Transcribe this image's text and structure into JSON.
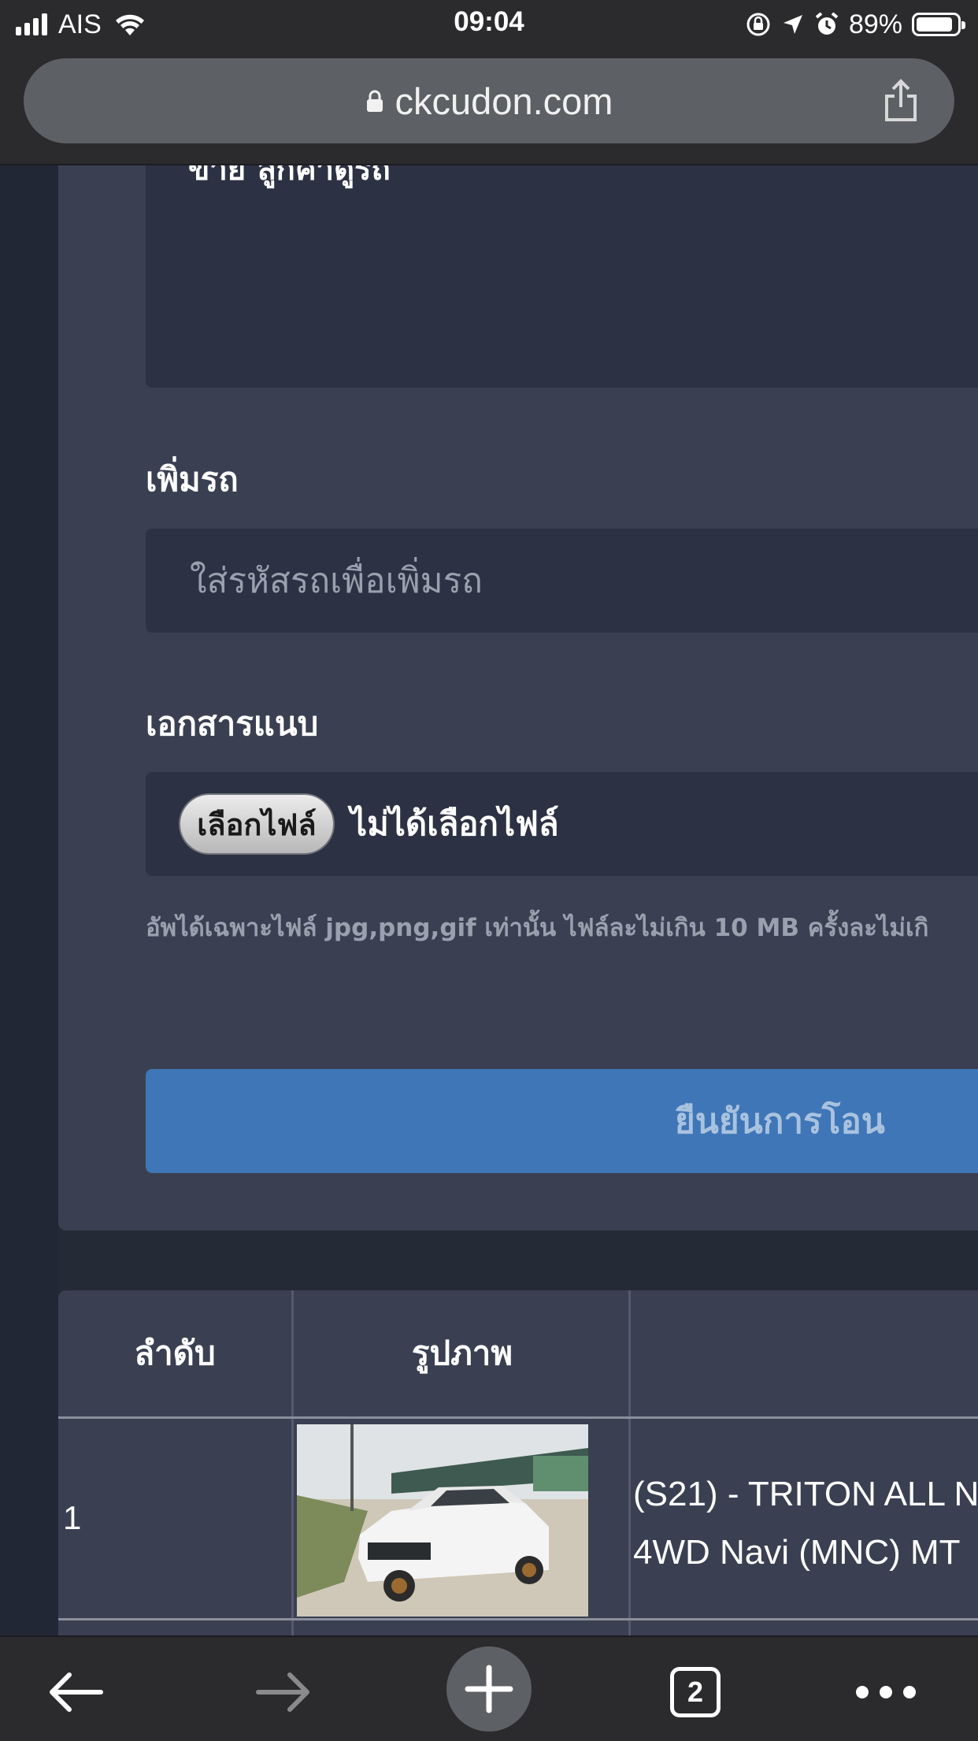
{
  "status_bar": {
    "carrier": "AIS",
    "time": "09:04",
    "battery": "89%",
    "battery_level": 0.89
  },
  "browser": {
    "url": "ckcudon.com",
    "tab_count": "2"
  },
  "form": {
    "clipped_text": "ขาย ลูกค้าดูรถ",
    "add_car_label": "เพิ่มรถ",
    "add_car_placeholder": "ใส่รหัสรถเพื่อเพิ่มรถ",
    "attachment_label": "เอกสารแนบ",
    "choose_file_button": "เลือกไฟล์",
    "no_file_text": "ไม่ได้เลือกไฟล์",
    "upload_hint": "อัพได้เฉพาะไฟล์ jpg,png,gif เท่านั้น ไฟล์ละไม่เกิน 10 MB ครั้งละไม่เกิ",
    "confirm_button": "ยืนยันการโอน"
  },
  "table": {
    "headers": [
      "ลำดับ",
      "รูปภาพ",
      ""
    ],
    "rows": [
      {
        "index": "1",
        "name_line1": "(S21) - TRITON ALL N",
        "name_line2": "4WD Navi (MNC) MT"
      }
    ]
  },
  "icons": [
    "signal-icon",
    "wifi-icon",
    "rotation-lock-icon",
    "location-arrow-icon",
    "alarm-icon",
    "battery-icon",
    "lock-icon",
    "share-icon",
    "back-arrow-icon",
    "forward-arrow-icon",
    "plus-icon",
    "more-icon"
  ]
}
